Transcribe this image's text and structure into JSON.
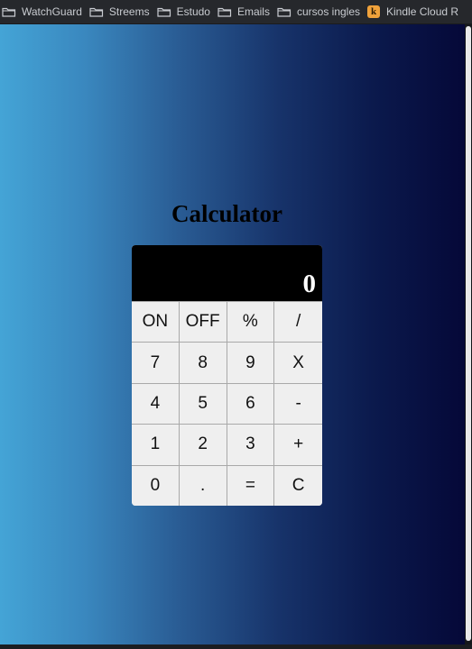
{
  "bookmarks": [
    {
      "label": "WatchGuard",
      "icon": "folder-icon"
    },
    {
      "label": "Streems",
      "icon": "folder-icon"
    },
    {
      "label": "Estudo",
      "icon": "folder-icon"
    },
    {
      "label": "Emails",
      "icon": "folder-icon"
    },
    {
      "label": "cursos ingles",
      "icon": "folder-icon"
    },
    {
      "label": "Kindle Cloud R",
      "icon": "kindle-icon",
      "icon_letter": "k"
    }
  ],
  "calculator": {
    "title": "Calculator",
    "display": "0",
    "keys": [
      [
        "ON",
        "OFF",
        "%",
        "/"
      ],
      [
        "7",
        "8",
        "9",
        "X"
      ],
      [
        "4",
        "5",
        "6",
        "-"
      ],
      [
        "1",
        "2",
        "3",
        "+"
      ],
      [
        "0",
        ".",
        "=",
        "C"
      ]
    ]
  },
  "colors": {
    "gradient_left": "#44a4d6",
    "gradient_right": "#050838",
    "display_bg": "#000000",
    "key_bg": "#efefef"
  }
}
